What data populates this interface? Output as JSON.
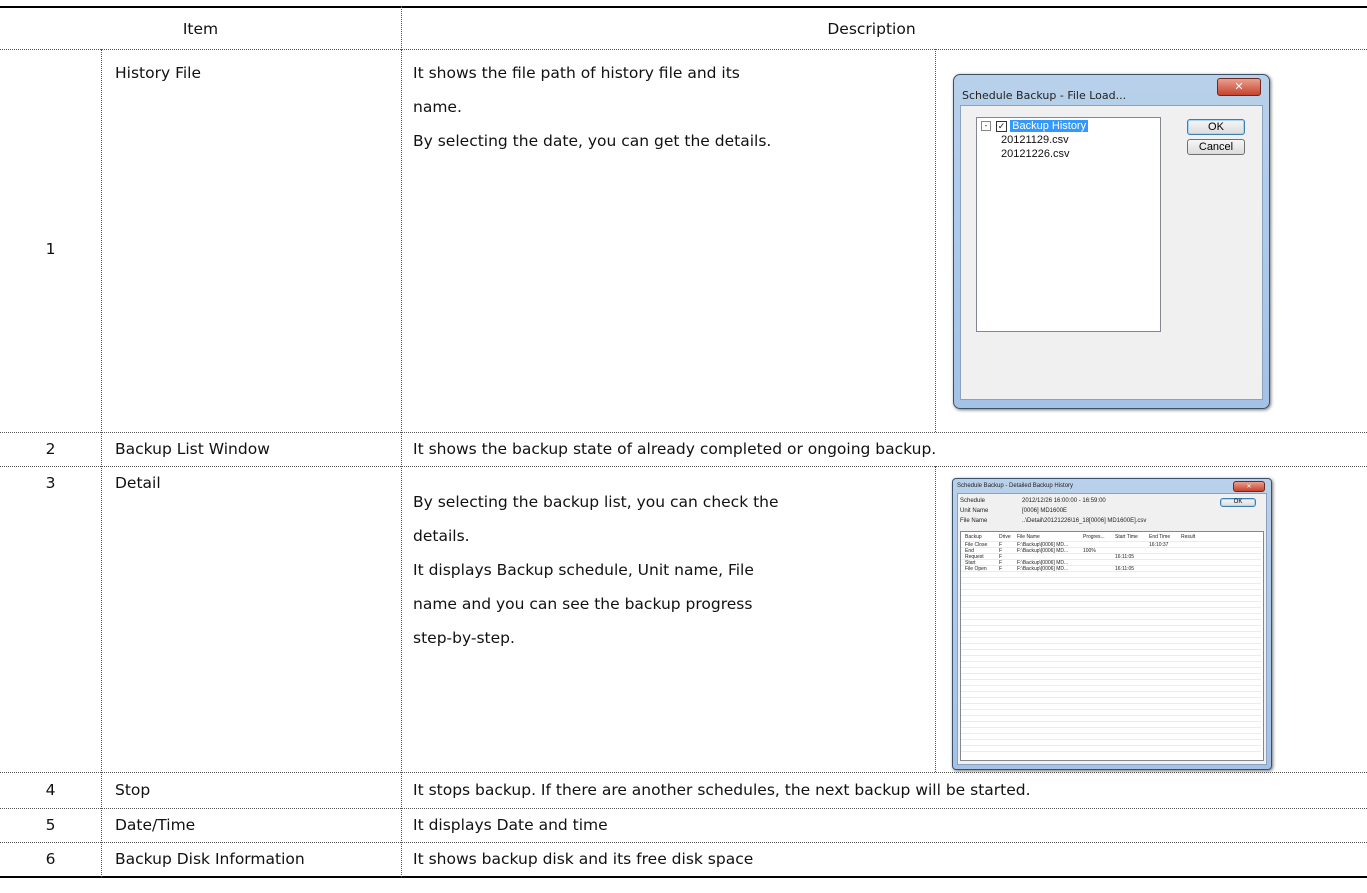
{
  "table": {
    "header": {
      "item": "Item",
      "description": "Description"
    },
    "rows": [
      {
        "num": "1",
        "item": "History File",
        "desc": [
          "It shows the file path of history file and its",
          "name.",
          "By selecting the date, you can get the details."
        ]
      },
      {
        "num": "2",
        "item": "Backup List Window",
        "desc": [
          "It shows the backup state of already completed or ongoing backup."
        ]
      },
      {
        "num": "3",
        "item": "Detail",
        "desc": [
          "By selecting the backup list, you can check the",
          "details.",
          "It displays Backup schedule, Unit name, File",
          "name and you can see the backup progress",
          "step-by-step."
        ]
      },
      {
        "num": "4",
        "item": "Stop",
        "desc": [
          "It stops backup. If there are another schedules, the next backup will be started."
        ]
      },
      {
        "num": "5",
        "item": "Date/Time",
        "desc": [
          "It displays Date and time"
        ]
      },
      {
        "num": "6",
        "item": "Backup Disk Information",
        "desc": [
          "It shows backup disk and its free disk space"
        ]
      }
    ]
  },
  "dialog_file_load": {
    "title": "Schedule Backup - File Load...",
    "close_glyph": "✕",
    "tree_root": "Backup History",
    "tree_items": [
      "20121129.csv",
      "20121226.csv"
    ],
    "ok_label": "OK",
    "cancel_label": "Cancel",
    "colors": {
      "frame": "#aecbec",
      "selection": "#3399ff"
    }
  },
  "dialog_detail": {
    "title": "Schedule Backup - Detailed Backup History",
    "fields": [
      {
        "label": "Schedule",
        "value": "2012/12/26  16:00:00 - 16:59:00"
      },
      {
        "label": "Unit Name",
        "value": "[0006] MD1600E"
      },
      {
        "label": "File Name",
        "value": "..\\Detail\\20121226\\16_18[0006] MD1600E].csv"
      }
    ],
    "ok_label": "OK",
    "columns": [
      "Backup",
      "Drive",
      "File Name",
      "Progres...",
      "Start Time",
      "End Time",
      "Result"
    ],
    "rows": [
      [
        "File Close",
        "F",
        "F:\\Backup\\[0006] MD...",
        "",
        "",
        "16:10:37",
        ""
      ],
      [
        "End",
        "F",
        "F:\\Backup\\[0006] MD...",
        "100%",
        "",
        "",
        ""
      ],
      [
        "Request",
        "F",
        "",
        "",
        "16:11:05",
        "",
        ""
      ],
      [
        "Start",
        "F",
        "F:\\Backup\\[0006] MD...",
        "",
        "",
        "",
        ""
      ],
      [
        "File Open",
        "F",
        "F:\\Backup\\[0006] MD...",
        "",
        "16:11:05",
        "",
        ""
      ]
    ]
  }
}
